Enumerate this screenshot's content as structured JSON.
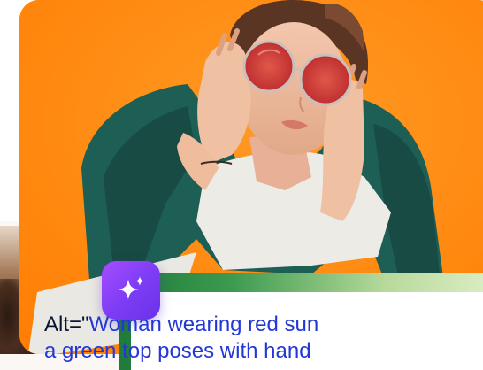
{
  "photo": {
    "alt_description_label": "Woman in red round sunglasses and green top holding her head"
  },
  "ai_button": {
    "icon": "sparkle-icon",
    "color_start": "#a64dff",
    "color_end": "#6a32e8"
  },
  "alt_text": {
    "prefix": "Alt=\"",
    "line1": "Woman wearing red sun",
    "line2": "a green top poses with hand"
  },
  "colors": {
    "photo_background": "#ff8a0f",
    "alt_value_text": "#2237d6",
    "panel_accent": "#3c9b4f"
  }
}
